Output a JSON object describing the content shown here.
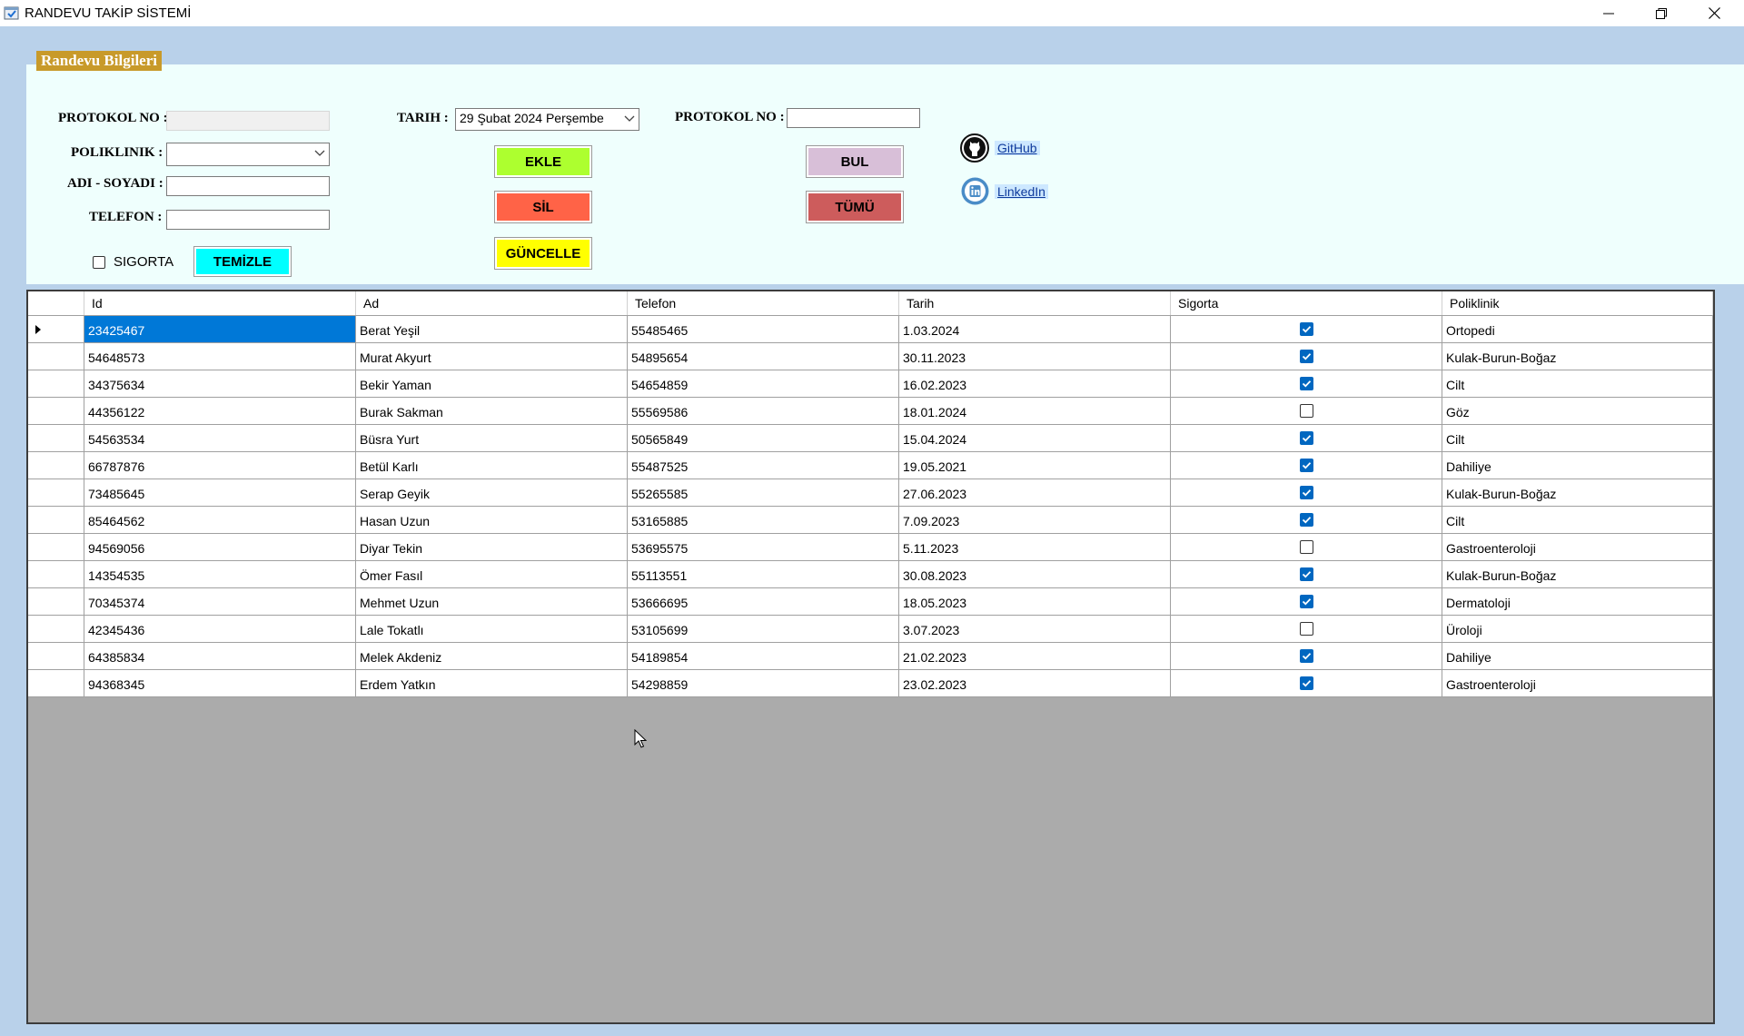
{
  "window": {
    "title": "RANDEVU TAKİP SİSTEMİ",
    "app_icon": "app-logo-icon",
    "controls": [
      "minimize-icon",
      "restore-icon",
      "close-icon"
    ]
  },
  "form": {
    "group_title": "Randevu Bilgileri",
    "protokol_label": "PROTOKOL NO :",
    "protokol_value": "",
    "poliklinik_label": "POLIKLINIK :",
    "poliklinik_value": "",
    "adsoyad_label": "ADI - SOYADI :",
    "adsoyad_value": "",
    "telefon_label": "TELEFON :",
    "telefon_value": "",
    "sigorta_label": "SIGORTA",
    "sigorta_checked": false,
    "temizle_label": "TEMİZLE",
    "tarih_label": "TARIH :",
    "tarih_value": "29  Şubat   2024 Perşembe",
    "ekle_label": "EKLE",
    "sil_label": "SİL",
    "guncelle_label": "GÜNCELLE",
    "search_protokol_label": "PROTOKOL NO :",
    "search_protokol_value": "",
    "bul_label": "BUL",
    "tumu_label": "TÜMÜ",
    "github_label": "GitHub",
    "linkedin_label": "LinkedIn"
  },
  "colors": {
    "ekle": "#adff2f",
    "sil": "#ff6347",
    "guncelle": "#ffff00",
    "temizle": "#00ffff",
    "bul": "#d8bfd8",
    "tumu": "#cd5c5c",
    "selection": "#0078d7",
    "legend": "#c89a2a"
  },
  "table": {
    "columns": [
      "Id",
      "Ad",
      "Telefon",
      "Tarih",
      "Sigorta",
      "Poliklinik"
    ],
    "selected_row": 0,
    "rows": [
      {
        "id": "23425467",
        "ad": "Berat Yeşil",
        "telefon": "55485465",
        "tarih": "1.03.2024",
        "sigorta": true,
        "poliklinik": "Ortopedi"
      },
      {
        "id": "54648573",
        "ad": "Murat Akyurt",
        "telefon": "54895654",
        "tarih": "30.11.2023",
        "sigorta": true,
        "poliklinik": "Kulak-Burun-Boğaz"
      },
      {
        "id": "34375634",
        "ad": "Bekir Yaman",
        "telefon": "54654859",
        "tarih": "16.02.2023",
        "sigorta": true,
        "poliklinik": "Cilt"
      },
      {
        "id": "44356122",
        "ad": "Burak Sakman",
        "telefon": "55569586",
        "tarih": "18.01.2024",
        "sigorta": false,
        "poliklinik": "Göz"
      },
      {
        "id": "54563534",
        "ad": "Büsra Yurt",
        "telefon": "50565849",
        "tarih": "15.04.2024",
        "sigorta": true,
        "poliklinik": "Cilt"
      },
      {
        "id": "66787876",
        "ad": "Betül Karlı",
        "telefon": "55487525",
        "tarih": "19.05.2021",
        "sigorta": true,
        "poliklinik": "Dahiliye"
      },
      {
        "id": "73485645",
        "ad": "Serap Geyik",
        "telefon": "55265585",
        "tarih": "27.06.2023",
        "sigorta": true,
        "poliklinik": "Kulak-Burun-Boğaz"
      },
      {
        "id": "85464562",
        "ad": "Hasan Uzun",
        "telefon": "53165885",
        "tarih": "7.09.2023",
        "sigorta": true,
        "poliklinik": "Cilt"
      },
      {
        "id": "94569056",
        "ad": "Diyar Tekin",
        "telefon": "53695575",
        "tarih": "5.11.2023",
        "sigorta": false,
        "poliklinik": "Gastroenteroloji"
      },
      {
        "id": "14354535",
        "ad": "Ömer Fasıl",
        "telefon": "55113551",
        "tarih": "30.08.2023",
        "sigorta": true,
        "poliklinik": "Kulak-Burun-Boğaz"
      },
      {
        "id": "70345374",
        "ad": "Mehmet Uzun",
        "telefon": "53666695",
        "tarih": "18.05.2023",
        "sigorta": true,
        "poliklinik": "Dermatoloji"
      },
      {
        "id": "42345436",
        "ad": "Lale Tokatlı",
        "telefon": "53105699",
        "tarih": "3.07.2023",
        "sigorta": false,
        "poliklinik": "Üroloji"
      },
      {
        "id": "64385834",
        "ad": "Melek Akdeniz",
        "telefon": "54189854",
        "tarih": "21.02.2023",
        "sigorta": true,
        "poliklinik": "Dahiliye"
      },
      {
        "id": "94368345",
        "ad": "Erdem Yatkın",
        "telefon": "54298859",
        "tarih": "23.02.2023",
        "sigorta": true,
        "poliklinik": "Gastroenteroloji"
      }
    ]
  }
}
